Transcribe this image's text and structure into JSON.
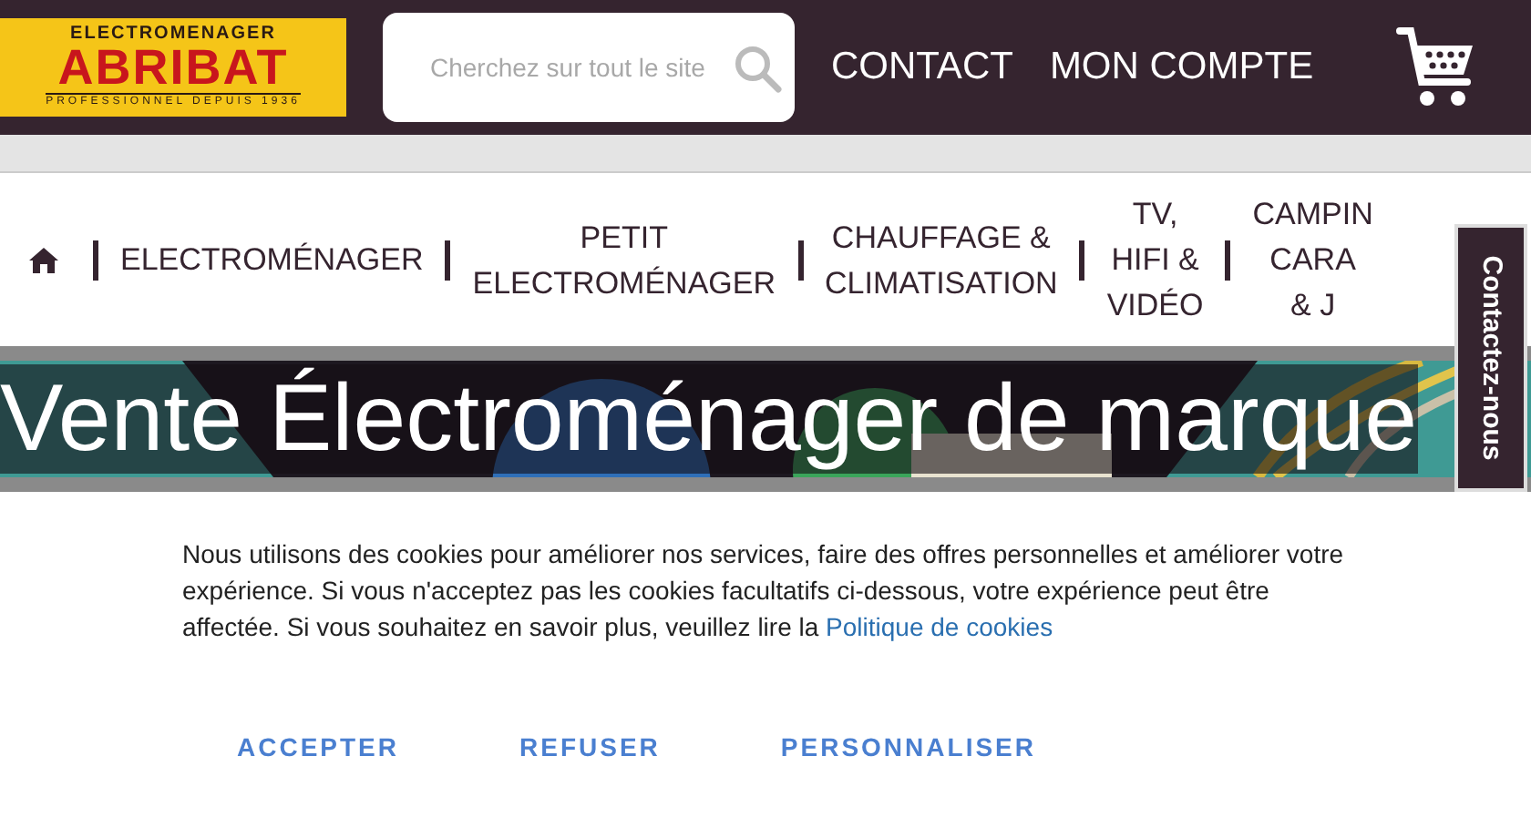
{
  "logo": {
    "top": "ELECTROMENAGER",
    "name": "ABRIBAT",
    "tagline": "PROFESSIONNEL DEPUIS 1936"
  },
  "search": {
    "placeholder": "Cherchez sur tout le site"
  },
  "header_links": [
    "CONTACT",
    "MON COMPTE"
  ],
  "nav": [
    {
      "lines": [
        "ELECTROMÉNAGER"
      ]
    },
    {
      "lines": [
        "PETIT",
        "ELECTROMÉNAGER"
      ]
    },
    {
      "lines": [
        "CHAUFFAGE &",
        "CLIMATISATION"
      ]
    },
    {
      "lines": [
        "TV,",
        "HIFI &",
        "VIDÉO"
      ]
    },
    {
      "lines": [
        "CAMPIN",
        "CARA",
        "& J"
      ]
    }
  ],
  "banner": {
    "title": "Vente Électroménager de marque"
  },
  "contact_tab": "Contactez-nous",
  "cookie": {
    "text": "Nous utilisons des cookies pour améliorer nos services, faire des offres personnelles et améliorer votre expérience. Si vous n'acceptez pas les cookies facultatifs ci-dessous, votre expérience peut être affectée. Si vous souhaitez en savoir plus, veuillez lire la",
    "link": "Politique de cookies",
    "buttons": [
      "ACCEPTER",
      "REFUSER",
      "PERSONNALISER"
    ]
  }
}
